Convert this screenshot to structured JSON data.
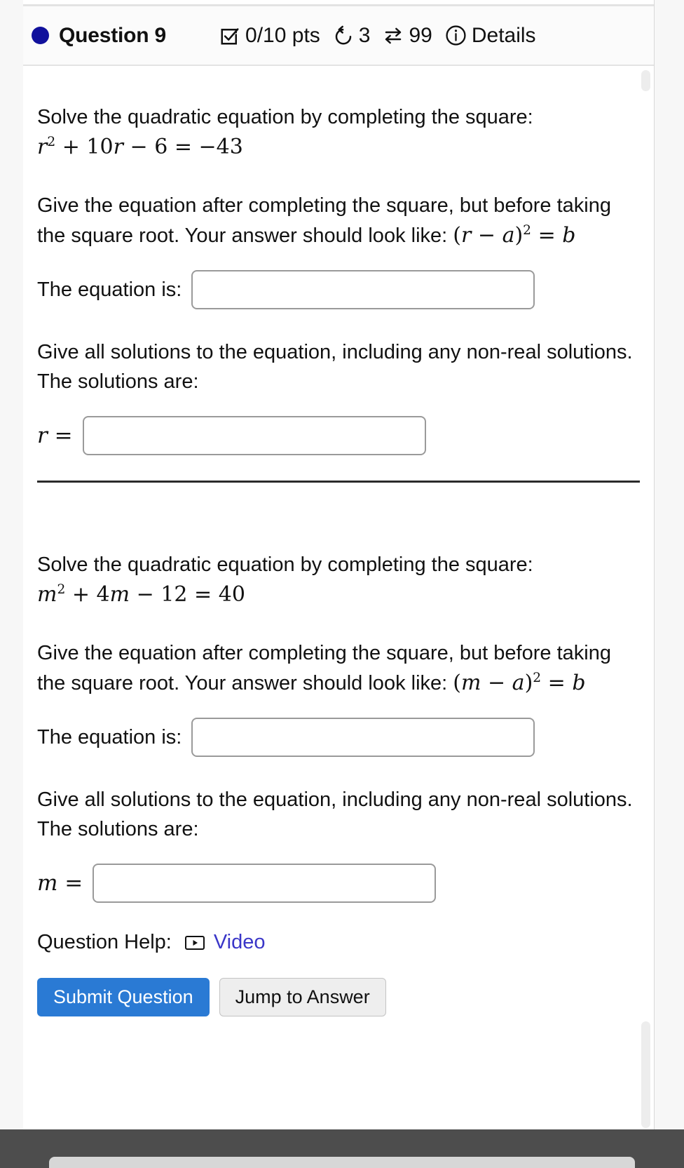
{
  "header": {
    "status_icon": "filled-circle",
    "title": "Question 9",
    "score_icon": "checkbox-checked-icon",
    "score": "0/10 pts",
    "attempts_icon": "undo-arrow-icon",
    "attempts": "3",
    "exchange_icon": "swap-arrows-icon",
    "exchange_count": "99",
    "info_icon": "info-circle-icon",
    "details_label": "Details"
  },
  "parts": [
    {
      "prompt_text": "Solve the quadratic equation by completing the square: ",
      "equation": {
        "var": "r",
        "exp": "2",
        "term1_op": "+",
        "term1": "10",
        "term1_var": "r",
        "term2_op": "−",
        "term2": "6",
        "eq": "=",
        "rhs": "−43"
      },
      "instructions_1": "Give the equation after completing the square, but before taking the square root. Your answer should look like: ",
      "form_hint": {
        "open": "(",
        "var": "r",
        "minus": "−",
        "a": "a",
        "close": ")",
        "exp": "2",
        "eq": "=",
        "b": "b"
      },
      "equation_label": "The equation is:",
      "equation_value": "",
      "equation_placeholder": "",
      "instructions_2": "Give all solutions to the equation, including any non-real solutions. The solutions are:",
      "solutions_label": "r =",
      "solutions_value": "",
      "solutions_placeholder": ""
    },
    {
      "prompt_text": "Solve the quadratic equation by completing the square: ",
      "equation": {
        "var": "m",
        "exp": "2",
        "term1_op": "+",
        "term1": "4",
        "term1_var": "m",
        "term2_op": "−",
        "term2": "12",
        "eq": "=",
        "rhs": "40"
      },
      "instructions_1": "Give the equation after completing the square, but before taking the square root. Your answer should look like: ",
      "form_hint": {
        "open": "(",
        "var": "m",
        "minus": "−",
        "a": "a",
        "close": ")",
        "exp": "2",
        "eq": "=",
        "b": "b"
      },
      "equation_label": "The equation is:",
      "equation_value": "",
      "equation_placeholder": "",
      "instructions_2": "Give all solutions to the equation, including any non-real solutions. The solutions are:",
      "solutions_label": "m =",
      "solutions_value": "",
      "solutions_placeholder": ""
    }
  ],
  "help": {
    "label": "Question Help:",
    "video_icon": "video-play-icon",
    "video_label": "Video"
  },
  "footer": {
    "submit_label": "Submit Question",
    "jump_label": "Jump to Answer"
  },
  "colors": {
    "status_dot": "#11119c",
    "primary_button": "#2a7ad4",
    "link": "#3a36c8"
  }
}
